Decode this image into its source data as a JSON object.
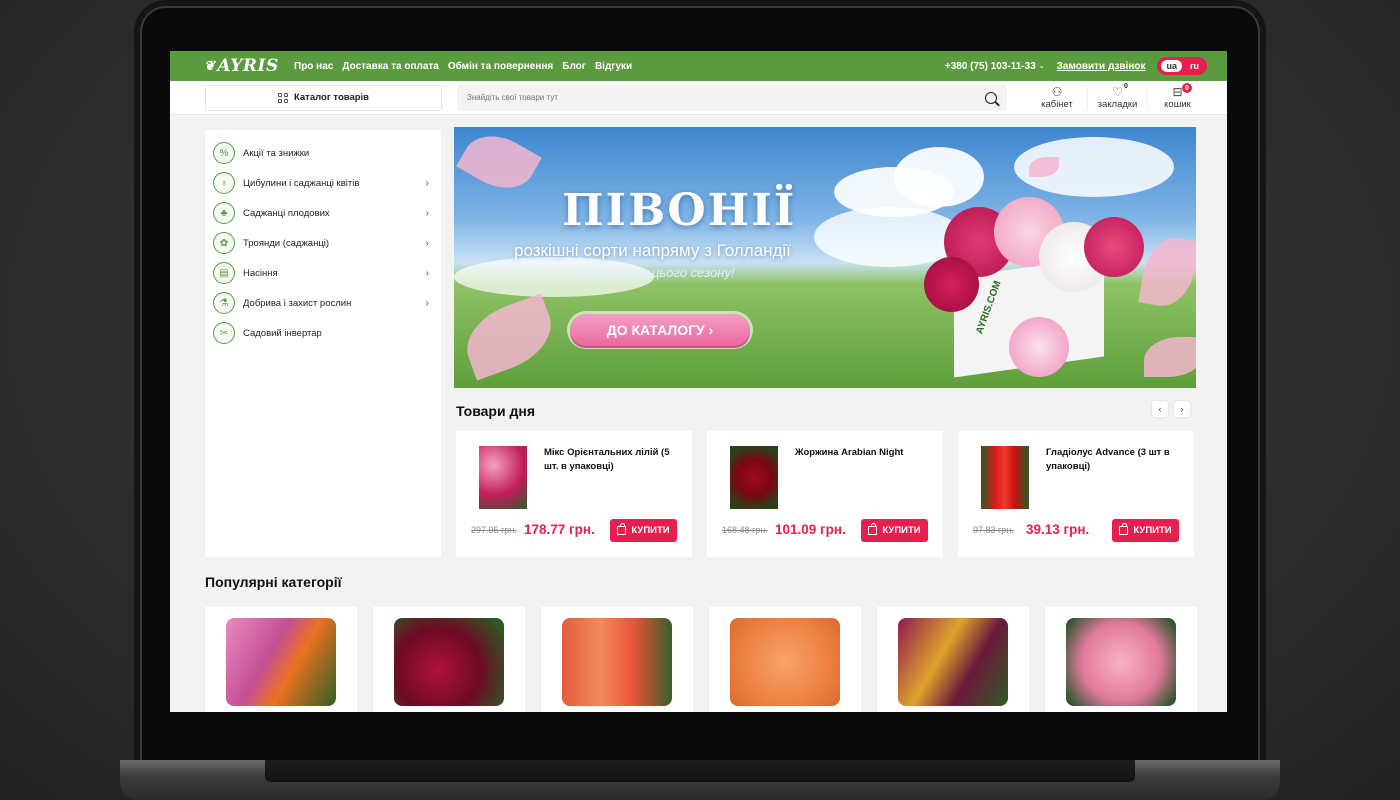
{
  "topbar": {
    "logo": "AYRIS",
    "nav": [
      "Про нас",
      "Доставка та оплата",
      "Обмін та повернення",
      "Блог",
      "Відгуки"
    ],
    "phone": "+380 (75) 103-11-33",
    "callback": "Замовити дзвінок",
    "lang_ua": "ua",
    "lang_ru": "ru"
  },
  "header": {
    "catalog_label": "Каталог товарів",
    "search_placeholder": "Знайдіть свої товари тут",
    "cabinet": "кабінет",
    "bookmarks": "закладки",
    "bookmarks_count": "0",
    "cart": "кошик",
    "cart_count": "0"
  },
  "sidebar": {
    "items": [
      {
        "label": "Акції та знижки",
        "icon": "percent-icon",
        "glyph": "%"
      },
      {
        "label": "Цибулини і саджанці квітів",
        "icon": "bulb-icon",
        "glyph": "♁"
      },
      {
        "label": "Саджанці плодових",
        "icon": "sapling-icon",
        "glyph": "♣"
      },
      {
        "label": "Троянди (саджанці)",
        "icon": "rose-icon",
        "glyph": "✿"
      },
      {
        "label": "Насіння",
        "icon": "seed-pack-icon",
        "glyph": "▤"
      },
      {
        "label": "Добрива і захист рослин",
        "icon": "fertilizer-icon",
        "glyph": "⚗"
      },
      {
        "label": "Садовий інвертар",
        "icon": "garden-tools-icon",
        "glyph": "✂"
      }
    ]
  },
  "banner": {
    "title": "ПІВОНІЇ",
    "subtitle": "розкішні сорти напряму з Голландії",
    "subtitle2": "цвітіння вже цього сезону!",
    "button": "ДО КАТАЛОГУ ›",
    "box_text": "AYRIS.COM"
  },
  "deals": {
    "title": "Товари дня",
    "prev": "‹",
    "next": "›",
    "products": [
      {
        "name": "Мікс Орієнтальних лілій (5 шт. в упаковці)",
        "old": "297.95 грн.",
        "price": "178.77 грн.",
        "buy": "КУПИТИ"
      },
      {
        "name": "Жоржина Arabian Night",
        "old": "168.48 грн.",
        "price": "101.09 грн.",
        "buy": "КУПИТИ"
      },
      {
        "name": "Гладіолус Advance (3 шт в упаковці)",
        "old": "97.83 грн.",
        "price": "39.13 грн.",
        "buy": "КУПИТИ"
      }
    ]
  },
  "categories": {
    "title": "Популярні категорії"
  },
  "colors": {
    "green": "#5c9a3f",
    "accent": "#e5204e"
  }
}
